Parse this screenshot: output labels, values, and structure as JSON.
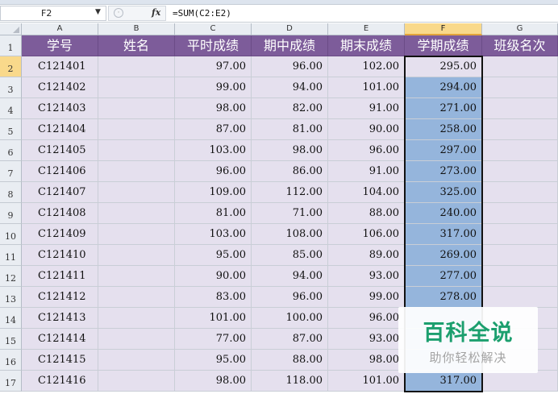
{
  "formula_bar": {
    "name_box": "F2",
    "formula": "=SUM(C2:E2)",
    "fx_label": "fx"
  },
  "columns": [
    "A",
    "B",
    "C",
    "D",
    "E",
    "F",
    "G"
  ],
  "active_column": "F",
  "headers": [
    "学号",
    "姓名",
    "平时成绩",
    "期中成绩",
    "期末成绩",
    "学期成绩",
    "班级名次"
  ],
  "row_numbers": [
    "1",
    "2",
    "3",
    "4",
    "5",
    "6",
    "7",
    "8",
    "9",
    "10",
    "11",
    "12",
    "13",
    "14",
    "15",
    "16",
    "17"
  ],
  "rows": [
    [
      "C121401",
      "",
      "97.00",
      "96.00",
      "102.00",
      "295.00",
      ""
    ],
    [
      "C121402",
      "",
      "99.00",
      "94.00",
      "101.00",
      "294.00",
      ""
    ],
    [
      "C121403",
      "",
      "98.00",
      "82.00",
      "91.00",
      "271.00",
      ""
    ],
    [
      "C121404",
      "",
      "87.00",
      "81.00",
      "90.00",
      "258.00",
      ""
    ],
    [
      "C121405",
      "",
      "103.00",
      "98.00",
      "96.00",
      "297.00",
      ""
    ],
    [
      "C121406",
      "",
      "96.00",
      "86.00",
      "91.00",
      "273.00",
      ""
    ],
    [
      "C121407",
      "",
      "109.00",
      "112.00",
      "104.00",
      "325.00",
      ""
    ],
    [
      "C121408",
      "",
      "81.00",
      "71.00",
      "88.00",
      "240.00",
      ""
    ],
    [
      "C121409",
      "",
      "103.00",
      "108.00",
      "106.00",
      "317.00",
      ""
    ],
    [
      "C121410",
      "",
      "95.00",
      "85.00",
      "89.00",
      "269.00",
      ""
    ],
    [
      "C121411",
      "",
      "90.00",
      "94.00",
      "93.00",
      "277.00",
      ""
    ],
    [
      "C121412",
      "",
      "83.00",
      "96.00",
      "99.00",
      "278.00",
      ""
    ],
    [
      "C121413",
      "",
      "101.00",
      "100.00",
      "96.00",
      "",
      ""
    ],
    [
      "C121414",
      "",
      "77.00",
      "87.00",
      "93.00",
      "",
      ""
    ],
    [
      "C121415",
      "",
      "95.00",
      "88.00",
      "98.00",
      "",
      ""
    ],
    [
      "C121416",
      "",
      "98.00",
      "118.00",
      "101.00",
      "317.00",
      ""
    ]
  ],
  "watermark": {
    "title": "百科全说",
    "subtitle": "助你轻松解决"
  },
  "colors": {
    "header_bg": "#7d5c9a",
    "cell_bg": "#e5e0ee",
    "selection_bg": "#95b5dc",
    "watermark_green": "#1c9f6e"
  }
}
